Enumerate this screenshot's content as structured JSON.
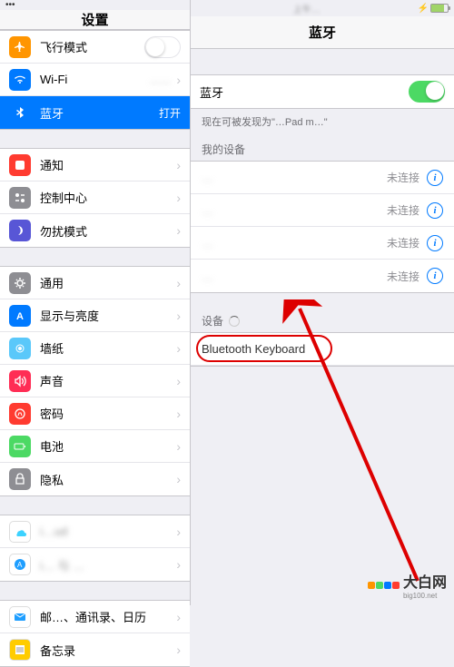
{
  "status": {
    "time_blur": "上午…",
    "battery_pct": 80
  },
  "left": {
    "title": "设置",
    "groups": [
      [
        {
          "icon": "airplane",
          "bg": "#ff9500",
          "label": "飞行模式",
          "kind": "toggle-off"
        },
        {
          "icon": "wifi",
          "bg": "#007aff",
          "label": "Wi-Fi",
          "value": "……",
          "value_blur": true,
          "chev": true
        },
        {
          "icon": "bluetooth",
          "bg": "#007aff",
          "label": "蓝牙",
          "value": "打开",
          "selected": true
        }
      ],
      [
        {
          "icon": "notif",
          "bg": "#ff3b30",
          "label": "通知",
          "chev": true
        },
        {
          "icon": "control",
          "bg": "#8e8e93",
          "label": "控制中心",
          "chev": true
        },
        {
          "icon": "dnd",
          "bg": "#5856d6",
          "label": "勿扰模式",
          "chev": true
        }
      ],
      [
        {
          "icon": "general",
          "bg": "#8e8e93",
          "label": "通用",
          "chev": true
        },
        {
          "icon": "display",
          "bg": "#007aff",
          "label": "显示与亮度",
          "chev": true
        },
        {
          "icon": "wallpaper",
          "bg": "#5ac8fa",
          "label": "墙纸",
          "chev": true
        },
        {
          "icon": "sound",
          "bg": "#ff2d55",
          "label": "声音",
          "chev": true
        },
        {
          "icon": "passcode",
          "bg": "#ff3b30",
          "label": "密码",
          "chev": true
        },
        {
          "icon": "battery",
          "bg": "#4cd964",
          "label": "电池",
          "chev": true
        },
        {
          "icon": "privacy",
          "bg": "#8e8e93",
          "label": "隐私",
          "chev": true
        }
      ],
      [
        {
          "icon": "icloud",
          "bg": "#ffffff",
          "label": "i…ud",
          "label_blur": true,
          "chev": true
        },
        {
          "icon": "appstore",
          "bg": "#ffffff",
          "label": "i… 与 …",
          "label_blur": true,
          "chev": true
        }
      ],
      [
        {
          "icon": "mail",
          "bg": "#fff",
          "label": "邮…、通讯录、日历",
          "chev": true
        },
        {
          "icon": "notes",
          "bg": "#fc0",
          "label": "备忘录",
          "chev": true
        }
      ]
    ]
  },
  "right": {
    "title": "蓝牙",
    "bt_row": {
      "label": "蓝牙"
    },
    "discover_text": "现在可被发现为\"…Pad m…\"",
    "my_devices_header": "我的设备",
    "my_devices": [
      {
        "name": "…",
        "status": "未连接"
      },
      {
        "name": "…",
        "status": "未连接"
      },
      {
        "name": "…",
        "status": "未连接"
      },
      {
        "name": "…",
        "status": "未连接"
      }
    ],
    "devices_header": "设备",
    "found_device": "Bluetooth Keyboard"
  },
  "watermark": {
    "brand": "大白网",
    "url": "big100.net"
  }
}
